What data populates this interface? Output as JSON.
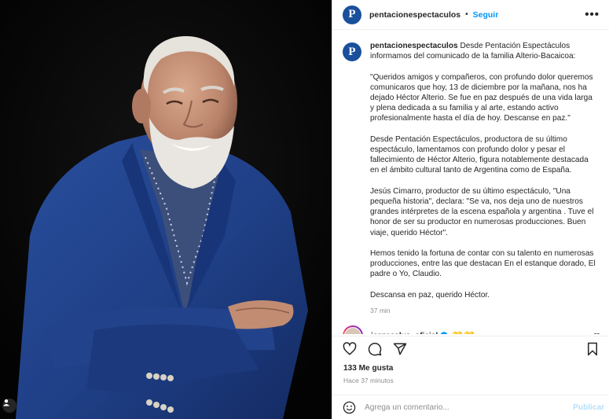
{
  "post": {
    "username": "pentacionespectaculos",
    "follow_label": "Seguir",
    "separator": "•",
    "more_label": "•••",
    "avatar_letter": "P"
  },
  "caption": {
    "username": "pentacionespectaculos",
    "paragraphs": [
      "Desde Pentación Espectáculos informamos del comunicado de la familia Alterio-Bacaicoa:",
      "\"Queridos amigos y compañeros, con profundo dolor queremos comunicaros que hoy, 13 de diciembre por la mañana, nos ha dejado Héctor Alterio. Se fue en paz después de una vida larga y plena dedicada a su familia y al arte, estando activo profesionalmente hasta el día de hoy. Descanse en paz.\"",
      "Desde Pentación Espectáculos, productora de su último espectáculo, lamentamos con profundo dolor y pesar el fallecimiento de Héctor Alterio, figura notablemente destacada en el ámbito cultural tanto de Argentina como de España.",
      "Jesús Cimarro, productor de su último espectáculo, \"Una pequeña historia\", declara: \"Se va, nos deja uno de nuestros grandes intérpretes de la escena española y argentina . Tuve el honor de ser su productor en numerosas producciones. Buen viaje, querido Héctor\".",
      "Hemos tenido la fortuna de contar con su talento en numerosas producciones, entre las que destacan En el estanque dorado, El padre o Yo, Claudio.",
      "Descansa en paz, querido Héctor."
    ],
    "time": "37 min"
  },
  "comment": {
    "username": "jorgecalvo_oficial",
    "emojis": "💛💛",
    "verified_icon": "verified-badge-icon",
    "verified_color": "#0095f6"
  },
  "actions": {
    "icons": [
      "heart-icon",
      "comment-icon",
      "share-icon",
      "bookmark-icon"
    ]
  },
  "likes": "133 Me gusta",
  "posted": "Hace 37 minutos",
  "add_comment": {
    "placeholder": "Agrega un comentario...",
    "publish_label": "Publicar",
    "publish_color": "#b2dffc"
  },
  "colors": {
    "accent": "#0095f6",
    "photo_background": "#060606",
    "suit": "#1f3f86"
  }
}
